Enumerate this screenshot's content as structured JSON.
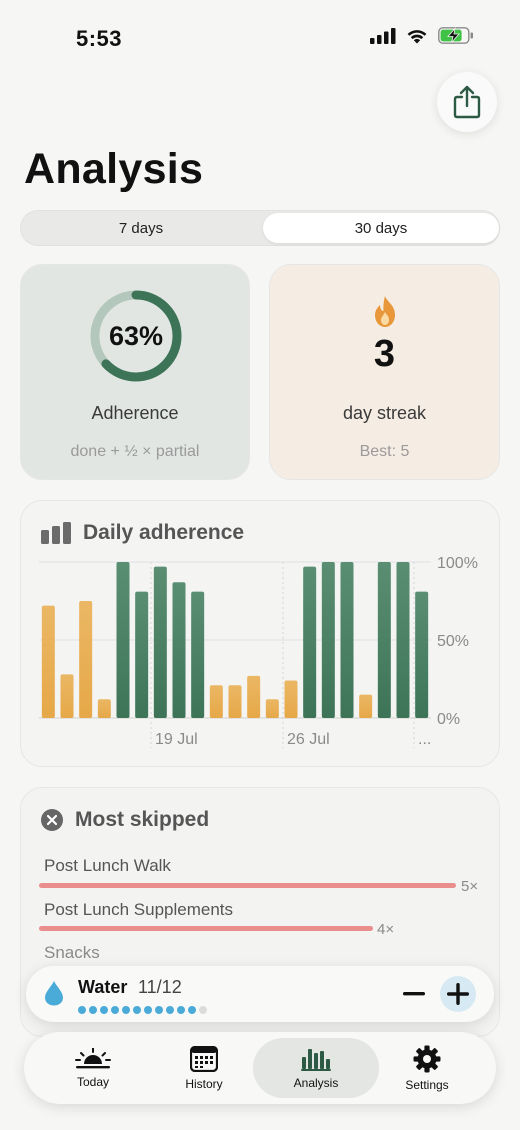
{
  "status_bar": {
    "time": "5:53"
  },
  "page": {
    "title": "Analysis"
  },
  "range_selector": {
    "options": [
      "7 days",
      "30 days"
    ],
    "selected": "30 days"
  },
  "adherence_card": {
    "percent": 63,
    "percent_text": "63%",
    "label": "Adherence",
    "note": "done + ½ × partial"
  },
  "streak_card": {
    "value": "3",
    "label": "day streak",
    "best": "Best: 5"
  },
  "daily_adherence": {
    "title": "Daily adherence",
    "chart_data": {
      "type": "bar",
      "values": [
        72,
        28,
        75,
        12,
        100,
        81,
        97,
        87,
        81,
        21,
        21,
        27,
        12,
        24,
        97,
        100,
        100,
        15,
        100,
        100,
        81
      ],
      "series_colors": [
        "orange",
        "orange",
        "orange",
        "orange",
        "green",
        "green",
        "green",
        "green",
        "green",
        "orange",
        "orange",
        "orange",
        "orange",
        "orange",
        "green",
        "green",
        "green",
        "orange",
        "green",
        "green",
        "green"
      ],
      "x_tick_labels": [
        "19 Jul",
        "26 Jul",
        "..."
      ],
      "y_tick_labels": [
        "100%",
        "50%",
        "0%"
      ],
      "ylim": [
        0,
        100
      ],
      "colors": {
        "orange": "#e6a848",
        "green": "#3d7457"
      }
    }
  },
  "most_skipped": {
    "title": "Most skipped",
    "items": [
      {
        "name": "Post Lunch Walk",
        "count": 5,
        "count_text": "5×"
      },
      {
        "name": "Post Lunch Supplements",
        "count": 4,
        "count_text": "4×"
      },
      {
        "name": "Snacks"
      }
    ]
  },
  "water": {
    "label": "Water",
    "count_text": "11/12",
    "filled": 11,
    "total": 12
  },
  "tab_bar": {
    "tabs": [
      {
        "label": "Today",
        "icon": "sunrise-icon"
      },
      {
        "label": "History",
        "icon": "calendar-icon"
      },
      {
        "label": "Analysis",
        "icon": "bar-chart-icon",
        "active": true
      },
      {
        "label": "Settings",
        "icon": "gear-icon"
      }
    ]
  },
  "colors": {
    "accent": "#3d7457",
    "orange": "#e6a848",
    "skip_bar": "#e98d8d",
    "water": "#4aaad8"
  }
}
